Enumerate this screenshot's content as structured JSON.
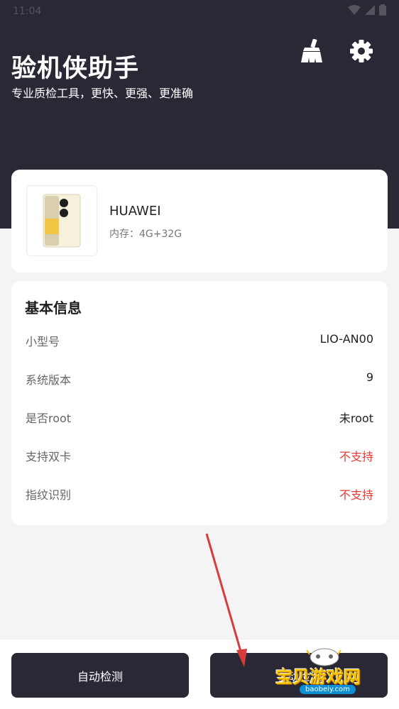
{
  "status_bar": {
    "time": "11:04"
  },
  "header": {
    "title": "验机侠助手",
    "subtitle": "专业质检工具，更快、更强、更准确",
    "clean_icon": "broom-icon",
    "settings_icon": "gear-icon"
  },
  "device": {
    "name": "HUAWEI",
    "memory": "内存：4G+32G"
  },
  "basic_info": {
    "title": "基本信息",
    "rows": [
      {
        "label": "小型号",
        "value": "LIO-AN00"
      },
      {
        "label": "系统版本",
        "value": "9"
      },
      {
        "label": "是否root",
        "value": "未root"
      },
      {
        "label": "支持双卡",
        "value": "不支持"
      },
      {
        "label": "指纹识别",
        "value": "不支持"
      }
    ]
  },
  "bottom": {
    "auto_label": "自动检测",
    "manual_label": "手动检测"
  },
  "watermark": {
    "text": "宝贝游戏网",
    "url": "baobeiy.com"
  },
  "colors": {
    "header_bg": "#2a2834",
    "negative": "#e53935",
    "button_bg": "#2a2834"
  }
}
